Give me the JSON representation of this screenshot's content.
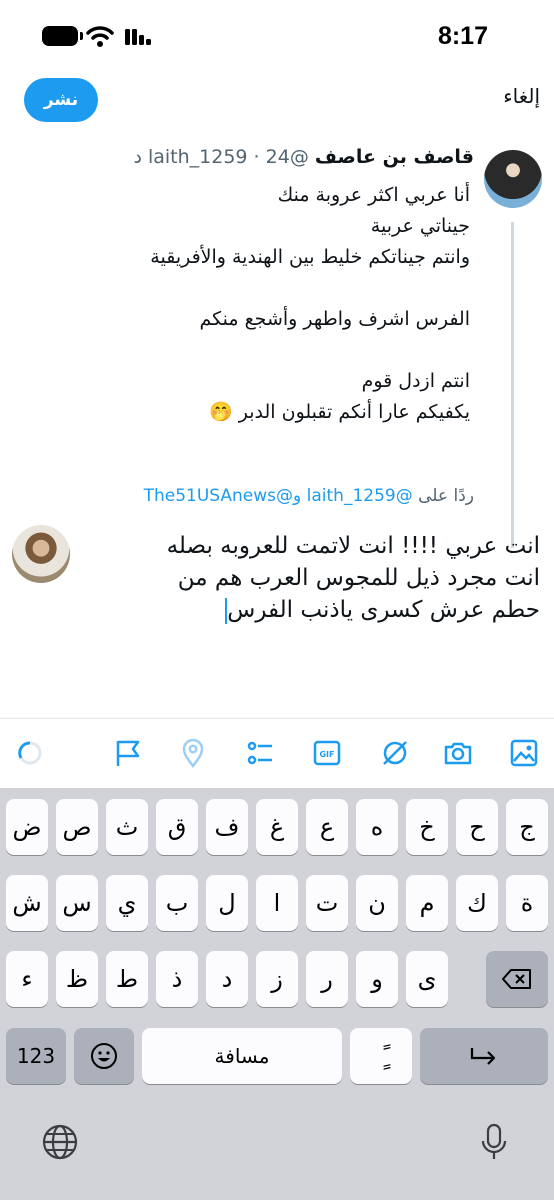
{
  "status": {
    "time": "8:17"
  },
  "header": {
    "post_label": "نشر",
    "cancel_label": "إلغاء"
  },
  "original": {
    "name": "قاصف بن عاصف",
    "handle": "@laith_1259",
    "separator": " · ",
    "age": "24 د",
    "lines": [
      "أنا عربي اكثر عروبة منك",
      "جيناتي عربية",
      "وانتم جيناتكم خليط بين الهندية والأفريقية",
      "",
      "الفرس اشرف واطهر وأشجع منكم",
      "",
      "انتم ازدل قوم",
      "يكفيكم عارا أنكم تقبلون الدبر 🤭"
    ]
  },
  "replying": {
    "prefix": "ردًا على ",
    "mention_1": "@laith_1259",
    "joiner": " و",
    "mention_2": "@The51USAnews"
  },
  "compose": {
    "lines": [
      "انت عربي !!!! انت لاتمت للعروبه بصله",
      "انت مجرد ذيل للمجوس العرب هم من",
      "حطم عرش كسرى ياذنب الفرس"
    ]
  },
  "toolbar": {
    "icons": [
      "image-icon",
      "camera-icon",
      "no-alt-icon",
      "gif-icon",
      "poll-icon",
      "location-icon",
      "flag-icon",
      "char-count-icon"
    ],
    "gif_label": "GIF"
  },
  "keyboard": {
    "row1": [
      "ض",
      "ص",
      "ث",
      "ق",
      "ف",
      "غ",
      "ع",
      "ه",
      "خ",
      "ح",
      "ج"
    ],
    "row2": [
      "ش",
      "س",
      "ي",
      "ب",
      "ل",
      "ا",
      "ت",
      "ن",
      "م",
      "ك",
      "ة"
    ],
    "row3": [
      "ء",
      "ظ",
      "ط",
      "ذ",
      "د",
      "ز",
      "ر",
      "و",
      "ى"
    ],
    "numbers_label": "123",
    "space_label": "مسافة",
    "diacritic_label": "ًٍ"
  },
  "colors": {
    "accent": "#1d9bf0",
    "muted": "#536471",
    "keyboard_bg": "#d1d3d9"
  }
}
